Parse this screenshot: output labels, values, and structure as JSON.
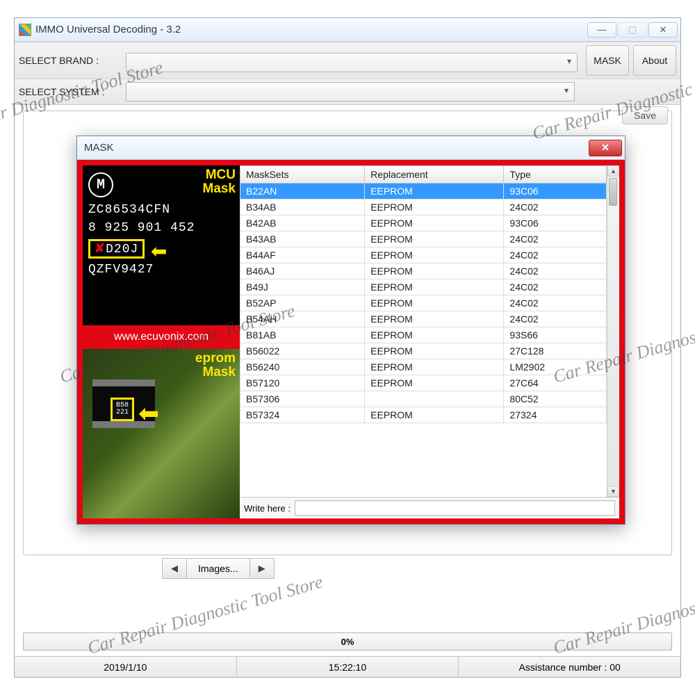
{
  "main": {
    "title": "IMMO Universal Decoding - 3.2",
    "labels": {
      "select_brand": "SELECT BRAND :",
      "select_system": "SELECT SYSTEM :"
    },
    "buttons": {
      "mask": "MASK",
      "about": "About",
      "save": "Save",
      "images": "Images..."
    },
    "progress_text": "0%",
    "status": {
      "date": "2019/1/10",
      "time": "15:22:10",
      "assistance": "Assistance number : 00"
    }
  },
  "dialog": {
    "title": "MASK",
    "left": {
      "mcu_label_line1": "MCU",
      "mcu_label_line2": "Mask",
      "chip_line1": "ZC86534CFN",
      "chip_line2": "8 925 901 452",
      "mask_value": "D20J",
      "chip_line4": "QZFV9427",
      "website": "www.ecuvonix.com",
      "eprom_label_line1": "eprom",
      "eprom_label_line2": "Mask",
      "eprom_chip_text": "B58 221"
    },
    "columns": {
      "c1": "MaskSets",
      "c2": "Replacement",
      "c3": "Type"
    },
    "rows": [
      {
        "m": "B22AN",
        "r": "EEPROM",
        "t": "93C06",
        "sel": true
      },
      {
        "m": "B34AB",
        "r": "EEPROM",
        "t": "24C02"
      },
      {
        "m": "B42AB",
        "r": "EEPROM",
        "t": "93C06"
      },
      {
        "m": "B43AB",
        "r": "EEPROM",
        "t": "24C02"
      },
      {
        "m": "B44AF",
        "r": "EEPROM",
        "t": "24C02"
      },
      {
        "m": "B46AJ",
        "r": "EEPROM",
        "t": "24C02"
      },
      {
        "m": "B49J",
        "r": "EEPROM",
        "t": "24C02"
      },
      {
        "m": "B52AP",
        "r": "EEPROM",
        "t": "24C02"
      },
      {
        "m": "B54AH",
        "r": "EEPROM",
        "t": "24C02"
      },
      {
        "m": "B81AB",
        "r": "EEPROM",
        "t": "93S66"
      },
      {
        "m": "B56022",
        "r": "EEPROM",
        "t": "27C128"
      },
      {
        "m": "B56240",
        "r": "EEPROM",
        "t": "LM2902"
      },
      {
        "m": "B57120",
        "r": "EEPROM",
        "t": "27C64"
      },
      {
        "m": "B57306",
        "r": "",
        "t": "80C52"
      },
      {
        "m": "B57324",
        "r": "EEPROM",
        "t": "27324"
      }
    ],
    "write_label": "Write here :",
    "write_value": ""
  },
  "watermark": "Car Repair Diagnostic Tool Store"
}
